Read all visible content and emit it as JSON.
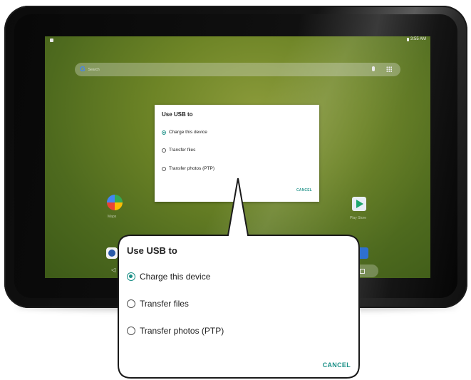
{
  "status_bar": {
    "time": "3:55 AM"
  },
  "home": {
    "search_placeholder": "Search",
    "apps": [
      {
        "name": "Maps",
        "label": "Maps"
      },
      {
        "name": "Play Store",
        "label": "Play Store"
      }
    ]
  },
  "usb_dialog": {
    "title": "Use USB to",
    "options": [
      {
        "label": "Charge this device",
        "selected": true
      },
      {
        "label": "Transfer files",
        "selected": false
      },
      {
        "label": "Transfer photos (PTP)",
        "selected": false
      }
    ],
    "cancel_label": "CANCEL"
  },
  "colors": {
    "accent": "#1a8f86"
  }
}
